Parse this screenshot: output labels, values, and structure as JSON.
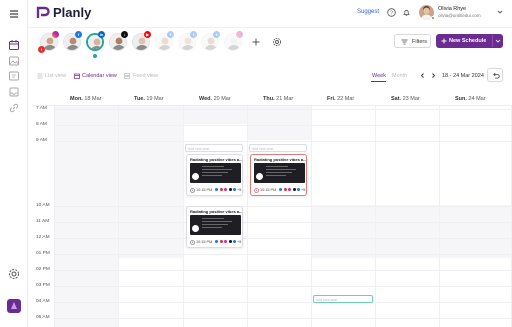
{
  "app": {
    "name": "Planly"
  },
  "header": {
    "suggest_label": "Suggest",
    "user_name": "Olivia Rhye",
    "user_email": "olivia@untitledui.com"
  },
  "toolbar": {
    "filters_label": "Filters",
    "new_schedule_label": "New Schedule"
  },
  "accounts": [
    {
      "network": "instagram",
      "status": "error"
    },
    {
      "network": "facebook"
    },
    {
      "network": "linkedin",
      "selected": true
    },
    {
      "network": "tiktok"
    },
    {
      "network": "youtube"
    },
    {
      "network": "facebook",
      "faded": true
    },
    {
      "network": "facebook",
      "faded": true
    },
    {
      "network": "facebook",
      "faded": true
    },
    {
      "network": "instagram",
      "faded": true
    }
  ],
  "views": {
    "list": "List view",
    "calendar": "Calendar view",
    "feed": "Feed view",
    "week": "Week",
    "month": "Month",
    "range": "18 - 24 Mar 2024"
  },
  "days": [
    {
      "name": "Mon.",
      "date": "18 Mar"
    },
    {
      "name": "Tue.",
      "date": "19 Mar"
    },
    {
      "name": "Wed.",
      "date": "20 Mar"
    },
    {
      "name": "Thu.",
      "date": "21 Mar"
    },
    {
      "name": "Fri.",
      "date": "22 Mar"
    },
    {
      "name": "Sat.",
      "date": "23 Mar"
    },
    {
      "name": "Sun.",
      "date": "24 Mar"
    }
  ],
  "times": [
    "7 AM",
    "8 AM",
    "9 AM",
    "10 AM",
    "11 AM",
    "12 AM",
    "01 PM",
    "02 PM",
    "03 PM",
    "04 AM",
    "05 AM"
  ],
  "placeholders": {
    "add_post": "Add new post",
    "add_post_fri": "Add new post"
  },
  "posts": [
    {
      "title": "Radiating positive vibes a...",
      "time": "10:15 PM",
      "more": "+5"
    },
    {
      "title": "Radiating positive vibes a...",
      "time": "10:15 PM",
      "more": "+5"
    },
    {
      "title": "Radiating positive vibes a...",
      "time": "10:15 PM",
      "more": "+5"
    }
  ],
  "colors": {
    "brand": "#6b2c91",
    "accent_blue": "#3b5bdb",
    "selected_ring": "#26a69a",
    "error": "#e03131"
  }
}
